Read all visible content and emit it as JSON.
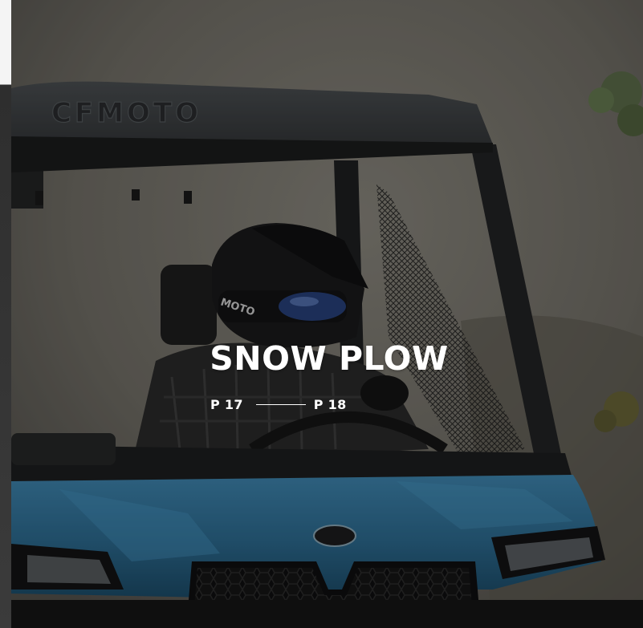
{
  "brand": {
    "roof_logo": "CFMOTO",
    "helmet_logo": "MOTO"
  },
  "section": {
    "title": "SNOW PLOW",
    "page_start": "P 17",
    "page_end": "P 18"
  },
  "colors": {
    "vehicle_blue": "#2f6f95",
    "roof_gray": "#3a3d3f",
    "background_haze": "#7d7a72",
    "text": "#ffffff"
  }
}
